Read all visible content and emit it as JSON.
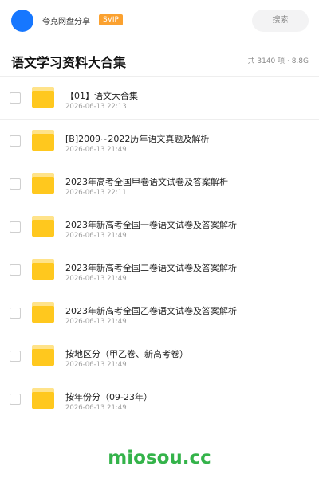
{
  "header": {
    "username": "夸克网盘分享",
    "badge": "SVIP",
    "search_label": "搜索",
    "accent_color": "#1677ff"
  },
  "folder": {
    "title": "语文学习资料大合集",
    "summary": "共 3140 项 · 8.8G"
  },
  "files": [
    {
      "name": "【01】语文大合集",
      "date": "2026-06-13 22:13",
      "icon": "folder-icon"
    },
    {
      "name": "[B]2009~2022历年语文真题及解析",
      "date": "2026-06-13 21:49",
      "icon": "folder-icon"
    },
    {
      "name": "2023年高考全国甲卷语文试卷及答案解析",
      "date": "2026-06-13 22:11",
      "icon": "folder-icon"
    },
    {
      "name": "2023年新高考全国一卷语文试卷及答案解析",
      "date": "2026-06-13 21:49",
      "icon": "folder-icon"
    },
    {
      "name": "2023年新高考全国二卷语文试卷及答案解析",
      "date": "2026-06-13 21:49",
      "icon": "folder-icon"
    },
    {
      "name": "2023年新高考全国乙卷语文试卷及答案解析",
      "date": "2026-06-13 21:49",
      "icon": "folder-icon"
    },
    {
      "name": "按地区分（甲乙卷、新高考卷）",
      "date": "2026-06-13 21:49",
      "icon": "folder-icon"
    },
    {
      "name": "按年份分（09-23年）",
      "date": "2026-06-13 21:49",
      "icon": "folder-icon"
    }
  ],
  "watermark": "miosou.cc"
}
